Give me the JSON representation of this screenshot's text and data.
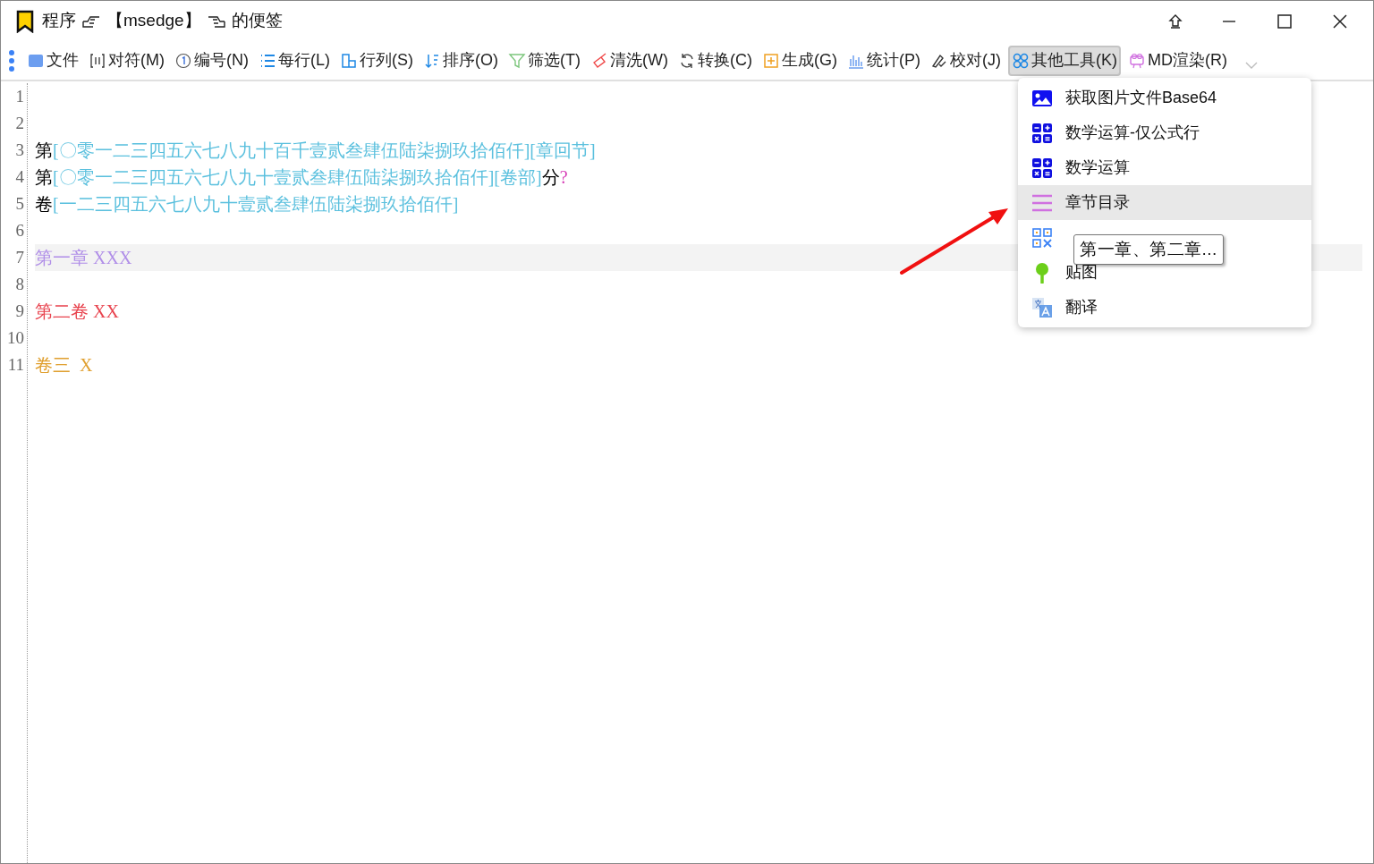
{
  "window": {
    "title_parts": [
      "程序",
      "【msedge】",
      "的便签"
    ]
  },
  "toolbar": [
    {
      "label": "文件",
      "selected": false
    },
    {
      "label": "对符(M)",
      "selected": false
    },
    {
      "label": "编号(N)",
      "selected": false
    },
    {
      "label": "每行(L)",
      "selected": false
    },
    {
      "label": "行列(S)",
      "selected": false
    },
    {
      "label": "排序(O)",
      "selected": false
    },
    {
      "label": "筛选(T)",
      "selected": false
    },
    {
      "label": "清洗(W)",
      "selected": false
    },
    {
      "label": "转换(C)",
      "selected": false
    },
    {
      "label": "生成(G)",
      "selected": false
    },
    {
      "label": "统计(P)",
      "selected": false
    },
    {
      "label": "校对(J)",
      "selected": false
    },
    {
      "label": "其他工具(K)",
      "selected": true
    },
    {
      "label": "MD渲染(R)",
      "selected": false
    }
  ],
  "editor": {
    "lines": [
      {
        "number": "1",
        "current": false
      },
      {
        "number": "2",
        "current": false
      },
      {
        "number": "3",
        "current": false,
        "segments": [
          {
            "text": "第",
            "color": "#000000"
          },
          {
            "text": "[〇零一二三四五六七八九十百千壹贰叁肆伍陆柒捌玖拾佰仟][章回节]",
            "color": "#5bc0de"
          }
        ]
      },
      {
        "number": "4",
        "current": false,
        "segments": [
          {
            "text": "第",
            "color": "#000000"
          },
          {
            "text": "[〇零一二三四五六七八九十壹贰叁肆伍陆柒捌玖拾佰仟][卷部]",
            "color": "#5bc0de"
          },
          {
            "text": "分",
            "color": "#000000"
          },
          {
            "text": "?",
            "color": "#d63ab5"
          }
        ]
      },
      {
        "number": "5",
        "current": false,
        "segments": [
          {
            "text": "卷",
            "color": "#000000"
          },
          {
            "text": "[一二三四五六七八九十壹贰叁肆伍陆柒捌玖拾佰仟]",
            "color": "#5bc0de"
          }
        ]
      },
      {
        "number": "6",
        "current": false
      },
      {
        "number": "7",
        "current": true,
        "segments": [
          {
            "text": "第一章 XXX",
            "color": "#b08ee8"
          }
        ]
      },
      {
        "number": "8",
        "current": false
      },
      {
        "number": "9",
        "current": false,
        "segments": [
          {
            "text": "第二卷 XX",
            "color": "#e8434e"
          }
        ]
      },
      {
        "number": "10",
        "current": false
      },
      {
        "number": "11",
        "current": false,
        "segments": [
          {
            "text": "卷三  X",
            "color": "#e0a030"
          }
        ]
      }
    ]
  },
  "menu": {
    "items": [
      {
        "label": "获取图片文件Base64",
        "selected": false
      },
      {
        "label": "数学运算-仅公式行",
        "selected": false
      },
      {
        "label": "数学运算",
        "selected": false
      },
      {
        "label": "章节目录",
        "selected": true
      },
      {
        "selected": false
      },
      {
        "label": "贴图",
        "selected": false
      },
      {
        "label": "翻译",
        "selected": false
      }
    ]
  },
  "tooltip": "第一章、第二章..."
}
